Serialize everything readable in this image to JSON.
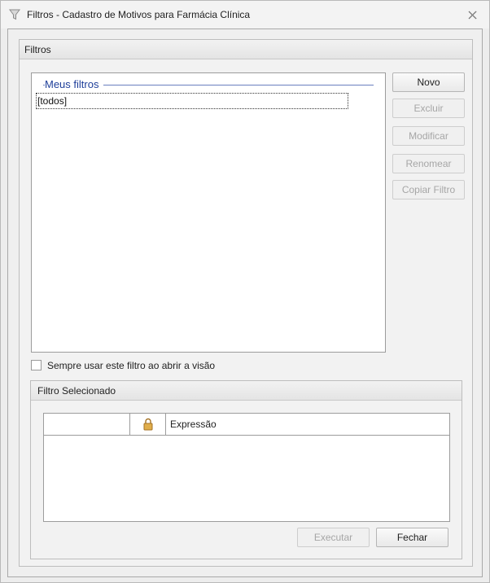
{
  "window": {
    "title": "Filtros - Cadastro de Motivos para Farmácia Clínica",
    "title_icon": "funnel-icon",
    "close_icon": "close-icon"
  },
  "filters_group": {
    "title": "Filtros",
    "list_header": "Meus filtros",
    "items": [
      "[todos]"
    ],
    "buttons": {
      "novo": "Novo",
      "excluir": "Excluir",
      "modificar": "Modificar",
      "renomear": "Renomear",
      "copiar": "Copiar Filtro"
    }
  },
  "always_use_checkbox": {
    "label": "Sempre usar este filtro ao abrir a visão",
    "checked": false
  },
  "selected_filter_group": {
    "title": "Filtro Selecionado",
    "grid": {
      "columns": [
        "",
        "lock-icon",
        "Expressão"
      ],
      "column_3_label": "Expressão",
      "rows": []
    },
    "buttons": {
      "executar": "Executar",
      "fechar": "Fechar"
    }
  },
  "colors": {
    "accent_text": "#1f3f9a",
    "disabled_text": "#a6a6a6",
    "lock": "#c8902c"
  }
}
